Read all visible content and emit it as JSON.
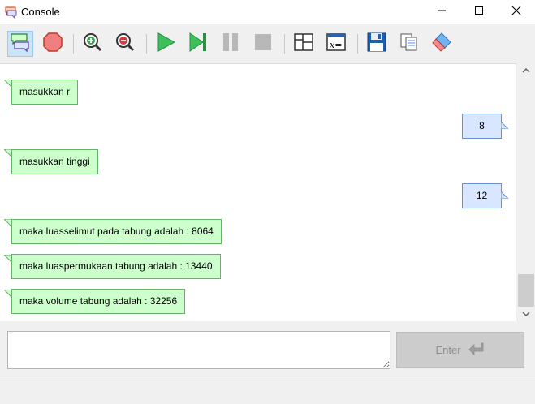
{
  "window": {
    "title": "Console",
    "icon": "console-app-icon",
    "controls": [
      "minimize-icon",
      "maximize-icon",
      "close-icon"
    ]
  },
  "toolbar": {
    "buttons": [
      {
        "name": "toggle-console-button",
        "icon": "console-bubbles-icon",
        "active": true
      },
      {
        "name": "stop-button",
        "icon": "stop-octagon-icon",
        "active": false
      },
      {
        "name": "zoom-in-button",
        "icon": "zoom-in-icon",
        "active": false
      },
      {
        "name": "zoom-out-button",
        "icon": "zoom-out-icon",
        "active": false
      },
      {
        "name": "run-button",
        "icon": "play-icon",
        "active": false
      },
      {
        "name": "step-button",
        "icon": "step-icon",
        "active": false
      },
      {
        "name": "pause-button",
        "icon": "pause-icon",
        "active": false
      },
      {
        "name": "terminate-button",
        "icon": "square-stop-icon",
        "active": false
      },
      {
        "name": "layout-button",
        "icon": "layout-icon",
        "active": false
      },
      {
        "name": "variables-button",
        "icon": "variable-x-icon",
        "active": false
      },
      {
        "name": "save-button",
        "icon": "floppy-disk-icon",
        "active": false
      },
      {
        "name": "copy-button",
        "icon": "copy-icon",
        "active": false
      },
      {
        "name": "clear-button",
        "icon": "eraser-icon",
        "active": false
      }
    ]
  },
  "console": {
    "messages": [
      {
        "kind": "output",
        "text": "masukkan r"
      },
      {
        "kind": "input",
        "text": "8"
      },
      {
        "kind": "output",
        "text": "masukkan tinggi"
      },
      {
        "kind": "input",
        "text": "12"
      },
      {
        "kind": "output",
        "text": "maka luasselimut pada tabung adalah : 8064"
      },
      {
        "kind": "output",
        "text": "maka luaspermukaan tabung adalah : 13440"
      },
      {
        "kind": "output",
        "text": "maka volume tabung adalah : 32256"
      }
    ]
  },
  "input": {
    "value": "",
    "placeholder": ""
  },
  "enter_button": {
    "label": "Enter",
    "icon": "enter-return-icon"
  },
  "colors": {
    "output_bubble": "#ccffcc",
    "output_border": "#66b266",
    "input_bubble": "#d9e6ff",
    "input_border": "#6b8fd6"
  }
}
